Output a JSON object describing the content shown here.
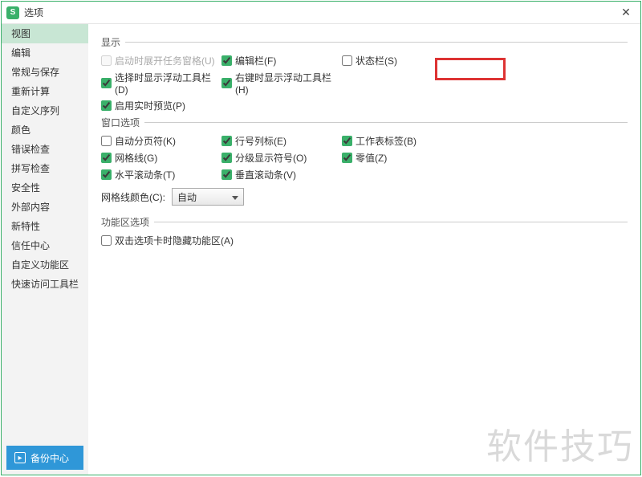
{
  "title": "选项",
  "close": "✕",
  "sidebar": {
    "items": [
      {
        "label": "视图",
        "active": true
      },
      {
        "label": "编辑"
      },
      {
        "label": "常规与保存"
      },
      {
        "label": "重新计算"
      },
      {
        "label": "自定义序列"
      },
      {
        "label": "颜色"
      },
      {
        "label": "错误检查"
      },
      {
        "label": "拼写检查"
      },
      {
        "label": "安全性"
      },
      {
        "label": "外部内容"
      },
      {
        "label": "新特性"
      },
      {
        "label": "信任中心"
      },
      {
        "label": "自定义功能区"
      },
      {
        "label": "快速访问工具栏"
      }
    ],
    "backup": "备份中心"
  },
  "sections": {
    "display": {
      "title": "显示",
      "startup_task_pane": "启动时展开任务窗格(U)",
      "edit_bar": "编辑栏(F)",
      "status_bar": "状态栏(S)",
      "show_float_toolbar": "选择时显示浮动工具栏(D)",
      "rclick_float_toolbar": "右键时显示浮动工具栏(H)",
      "realtime_preview": "启用实时预览(P)"
    },
    "window": {
      "title": "窗口选项",
      "page_break": "自动分页符(K)",
      "row_col_header": "行号列标(E)",
      "sheet_tabs": "工作表标签(B)",
      "gridlines": "网格线(G)",
      "outline_symbols": "分级显示符号(O)",
      "zero_values": "零值(Z)",
      "hscroll": "水平滚动条(T)",
      "vscroll": "垂直滚动条(V)",
      "grid_color_label": "网格线颜色(C):",
      "grid_color_value": "自动"
    },
    "ribbon": {
      "title": "功能区选项",
      "dblclick_hide": "双击选项卡时隐藏功能区(A)"
    }
  },
  "watermark": "软件技巧",
  "app_icon": "S"
}
